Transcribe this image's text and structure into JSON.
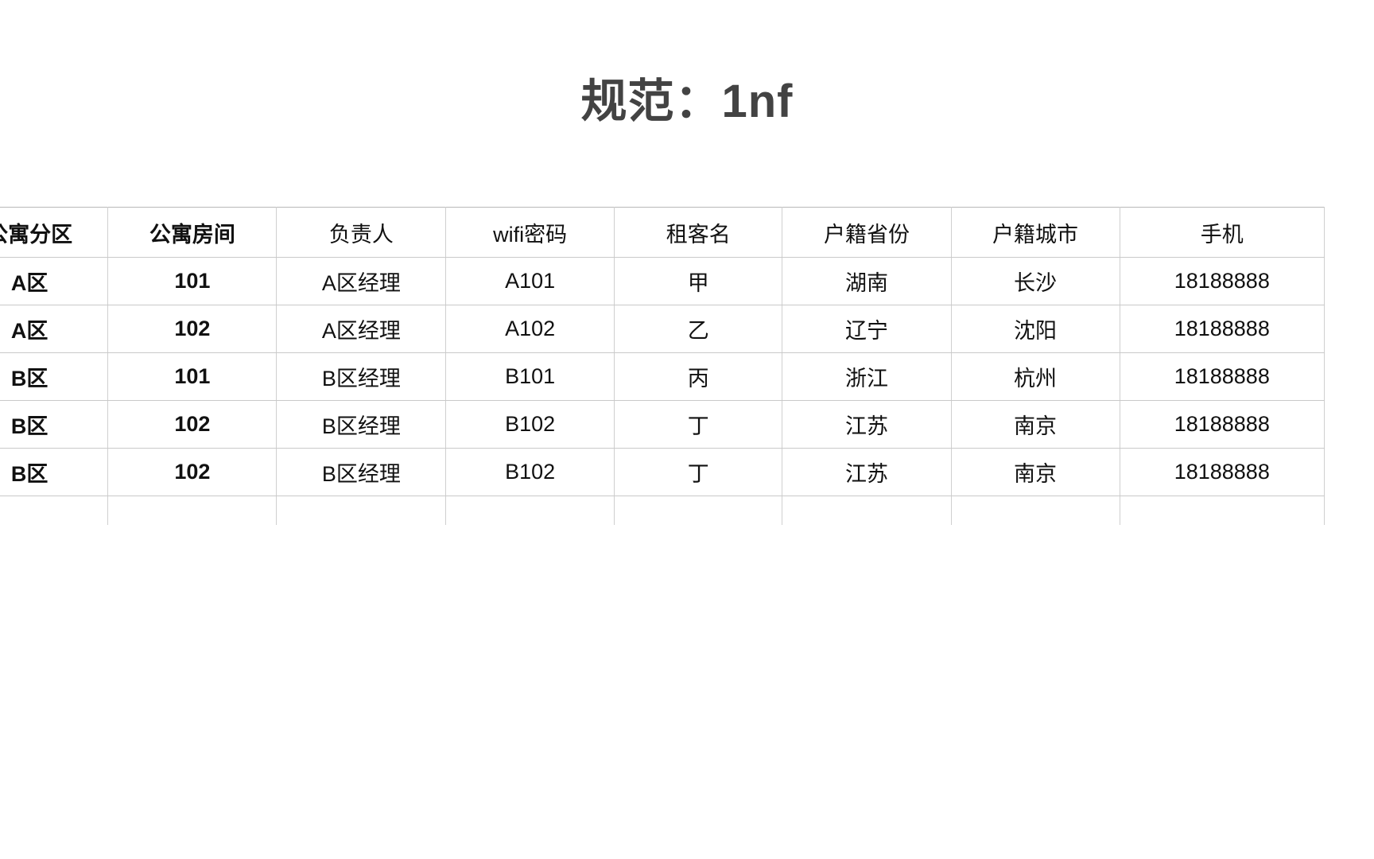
{
  "slide": {
    "title": "规范：1nf",
    "title_color": "#434343",
    "background_color": "#ffffff"
  },
  "table": {
    "border_color": "#c9c9c9",
    "columns": [
      {
        "key": "zone",
        "label": "公寓分区",
        "bold": true,
        "clipped_left": true
      },
      {
        "key": "room",
        "label": "公寓房间",
        "bold": true,
        "clipped_left": false
      },
      {
        "key": "manager",
        "label": "负责人",
        "bold": false,
        "clipped_left": false
      },
      {
        "key": "wifi",
        "label": "wifi密码",
        "bold": false,
        "clipped_left": false
      },
      {
        "key": "tenant",
        "label": "租客名",
        "bold": false,
        "clipped_left": false
      },
      {
        "key": "province",
        "label": "户籍省份",
        "bold": false,
        "clipped_left": false
      },
      {
        "key": "city",
        "label": "户籍城市",
        "bold": false,
        "clipped_left": false
      },
      {
        "key": "phone",
        "label": "手机",
        "bold": false,
        "clipped_right": true
      }
    ],
    "rows": [
      {
        "zone": "A区",
        "room": "101",
        "manager": "A区经理",
        "wifi": "A101",
        "tenant": "甲",
        "province": "湖南",
        "city": "长沙",
        "phone": "18188888"
      },
      {
        "zone": "A区",
        "room": "102",
        "manager": "A区经理",
        "wifi": "A102",
        "tenant": "乙",
        "province": "辽宁",
        "city": "沈阳",
        "phone": "18188888"
      },
      {
        "zone": "B区",
        "room": "101",
        "manager": "B区经理",
        "wifi": "B101",
        "tenant": "丙",
        "province": "浙江",
        "city": "杭州",
        "phone": "18188888"
      },
      {
        "zone": "B区",
        "room": "102",
        "manager": "B区经理",
        "wifi": "B102",
        "tenant": "丁",
        "province": "江苏",
        "city": "南京",
        "phone": "18188888"
      },
      {
        "zone": "B区",
        "room": "102",
        "manager": "B区经理",
        "wifi": "B102",
        "tenant": "丁",
        "province": "江苏",
        "city": "南京",
        "phone": "18188888"
      }
    ],
    "empty_row": {
      "zone": "",
      "room": "",
      "manager": "",
      "wifi": "",
      "tenant": "",
      "province": "",
      "city": "",
      "phone": ""
    },
    "bold_columns": [
      "zone",
      "room"
    ]
  }
}
